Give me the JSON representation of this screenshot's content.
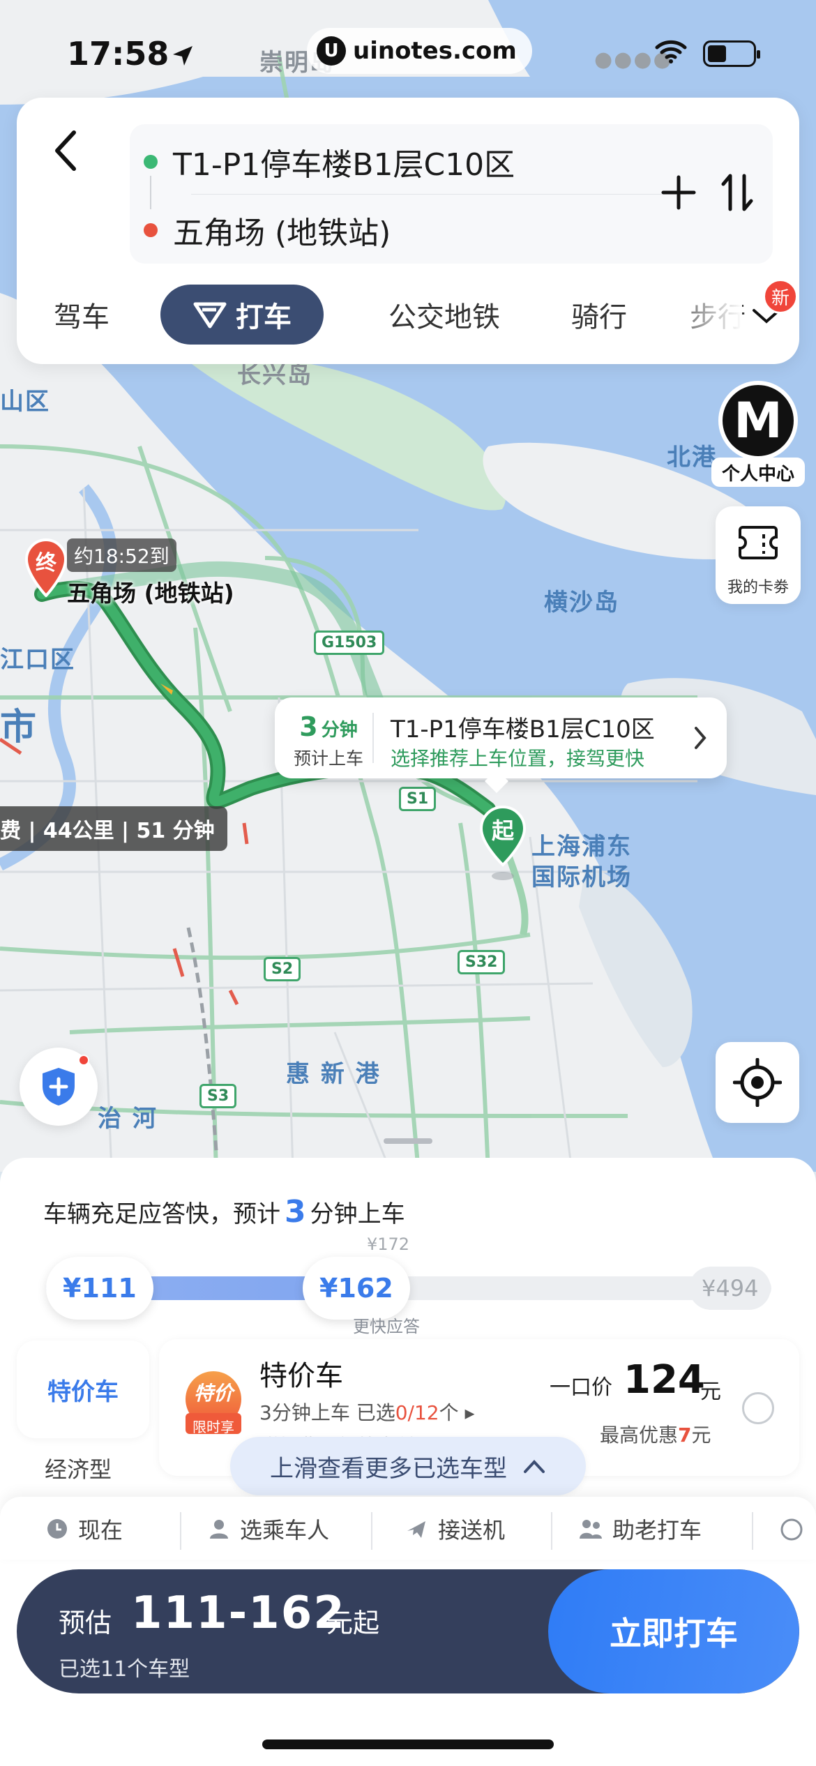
{
  "status_bar": {
    "time": "17:58",
    "url": "uinotes.com",
    "url_logo": "U"
  },
  "route": {
    "from": "T1-P1停车楼B1层C10区",
    "to": "五角场 (地铁站)",
    "from_color": "#3bb874",
    "to_color": "#e8523e"
  },
  "modes": [
    {
      "label": "驾车"
    },
    {
      "label": "打车"
    },
    {
      "label": "公交地铁"
    },
    {
      "label": "骑行"
    },
    {
      "label": "步行"
    }
  ],
  "new_badge": "新",
  "side_buttons": {
    "profile_logo": "M",
    "profile_label": "个人中心",
    "card_label": "我的卡劵"
  },
  "map": {
    "labels": {
      "chongming": "崇明岛",
      "changxing": "长兴岛",
      "beigang": "北港",
      "hengsha": "横沙岛",
      "shanqu": "山区",
      "hongkou": "江口区",
      "shi": "市",
      "pudong_airport": "上海浦东\n国际机场",
      "huixin": "惠 新 港",
      "zhihe": "治 河"
    },
    "shields": [
      "G1503",
      "S1",
      "S2",
      "S32",
      "S3"
    ],
    "destination": {
      "marker": "终",
      "eta": "约18:52到",
      "name": "五角场 (地铁站)"
    },
    "route_summary": "费 | 44公里 | 51 分钟",
    "pickup_tip": {
      "minutes": "3",
      "unit": "分钟",
      "sub": "预计上车",
      "place": "T1-P1停车楼B1层C10区",
      "hint": "选择推荐上车位置，接驾更快"
    },
    "start_marker": "起"
  },
  "sheet": {
    "headline_pre": "车辆充足应答快，预计",
    "headline_num": "3",
    "headline_post": "分钟上车",
    "price_slider": {
      "low": "¥111",
      "high": "¥162",
      "above_label": "¥172",
      "below_label": "更快应答",
      "max": "¥494"
    },
    "category_active": "特价车",
    "category_next": "经济型",
    "car": {
      "logo_top": "特价",
      "logo_bottom": "限时享",
      "name": "特价车",
      "meta_pre": "3分钟上车   已选",
      "meta_sel": "0/12",
      "meta_post": "个",
      "faded": "附加费需额外支付",
      "fixed_label": "一口价",
      "price": "124",
      "yuan": "元",
      "disc_pre": "最高优惠",
      "disc_num": "7",
      "disc_post": "元"
    },
    "swipe_hint": "上滑查看更多已选车型",
    "options": [
      {
        "label": "现在",
        "icon": "clock-icon"
      },
      {
        "label": "选乘车人",
        "icon": "person-icon"
      },
      {
        "label": "接送机",
        "icon": "plane-icon"
      },
      {
        "label": "助老打车",
        "icon": "elder-icon"
      }
    ],
    "action": {
      "estimate_label": "预估",
      "range": "111-162",
      "suffix": "元起",
      "selected": "已选11个车型",
      "go": "立即打车"
    }
  },
  "colors": {
    "accent": "#3a7bea",
    "route_green": "#2e9b5c",
    "dark_navy": "#343f5c",
    "red": "#e8523e"
  }
}
